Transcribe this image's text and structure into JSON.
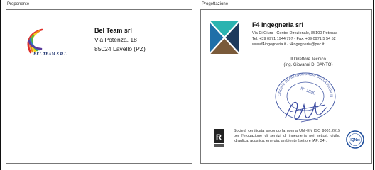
{
  "proponent": {
    "section_label": "Proponente",
    "company_name": "Bel Team srl",
    "logo_text": "BEL TEAM S.R.L.",
    "address": "Via Potenza, 18",
    "city": "85024 Lavello (PZ)"
  },
  "designer": {
    "section_label": "Progettazione",
    "company_name": "F4 ingegneria srl",
    "address": "Via Di Giura - Centro Direzionale, 85100 Potenza",
    "contacts": "Tel: +39 0971 1944 797 - Fax: +39 0971 5 54 52",
    "web": "www.f4ingegneria.it - f4ingegneria@pec.it",
    "director_title": "Il Direttore Tecnico",
    "director_name": "(ing. Giovanni DI SANTO)",
    "seal_text": "ORDINE DEGLI INGEGNERI DELLA PROVINCIA DI POTENZA",
    "seal_number": "N° 1800",
    "certification": "Società certificata secondo la norma UNI-EN ISO 9001:2015 per l'erogazione di servizi di ingegneria nei settori: civile, idraulica, acustica, energia, ambiente (settore IAF: 34).",
    "iqnet_text": "IQNet"
  },
  "colors": {
    "border": "#777777",
    "f4_blue": "#1f6fa8",
    "f4_teal": "#2bb3b0",
    "f4_brown": "#7a5a3a",
    "f4_dark": "#1d3a5c",
    "seal_blue": "#4a5fa8",
    "signature_blue": "#3848a0"
  }
}
